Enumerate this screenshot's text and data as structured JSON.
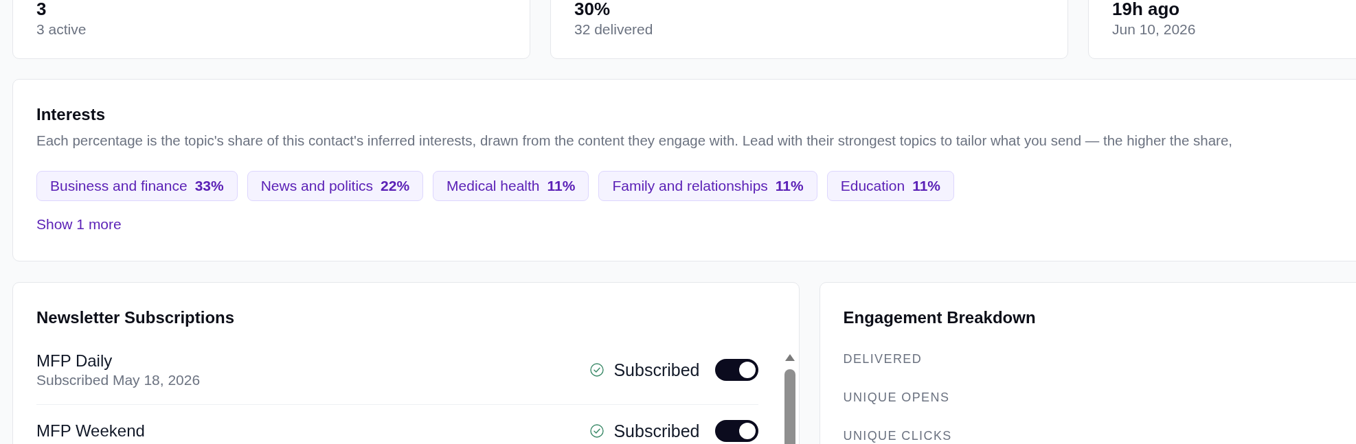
{
  "stats": [
    {
      "value": "3",
      "detail": "3 active"
    },
    {
      "value": "30%",
      "detail": "32 delivered"
    },
    {
      "value": "19h ago",
      "detail": "Jun 10, 2026"
    }
  ],
  "interests": {
    "title": "Interests",
    "description": "Each percentage is the topic's share of this contact's inferred interests, drawn from the content they engage with. Lead with their strongest topics to tailor what you send — the higher the share,",
    "topics": [
      {
        "name": "Business and finance",
        "share": "33%"
      },
      {
        "name": "News and politics",
        "share": "22%"
      },
      {
        "name": "Medical health",
        "share": "11%"
      },
      {
        "name": "Family and relationships",
        "share": "11%"
      },
      {
        "name": "Education",
        "share": "11%"
      }
    ],
    "show_more": "Show 1 more"
  },
  "newsletter_subscriptions": {
    "title": "Newsletter Subscriptions",
    "items": [
      {
        "name": "MFP Daily",
        "date": "Subscribed May 18, 2026",
        "status": "Subscribed",
        "subscribed": true
      },
      {
        "name": "MFP Weekend",
        "status": "Subscribed",
        "subscribed": true
      }
    ]
  },
  "engagement_breakdown": {
    "title": "Engagement Breakdown",
    "metrics": [
      "DELIVERED",
      "UNIQUE OPENS",
      "UNIQUE CLICKS"
    ]
  }
}
